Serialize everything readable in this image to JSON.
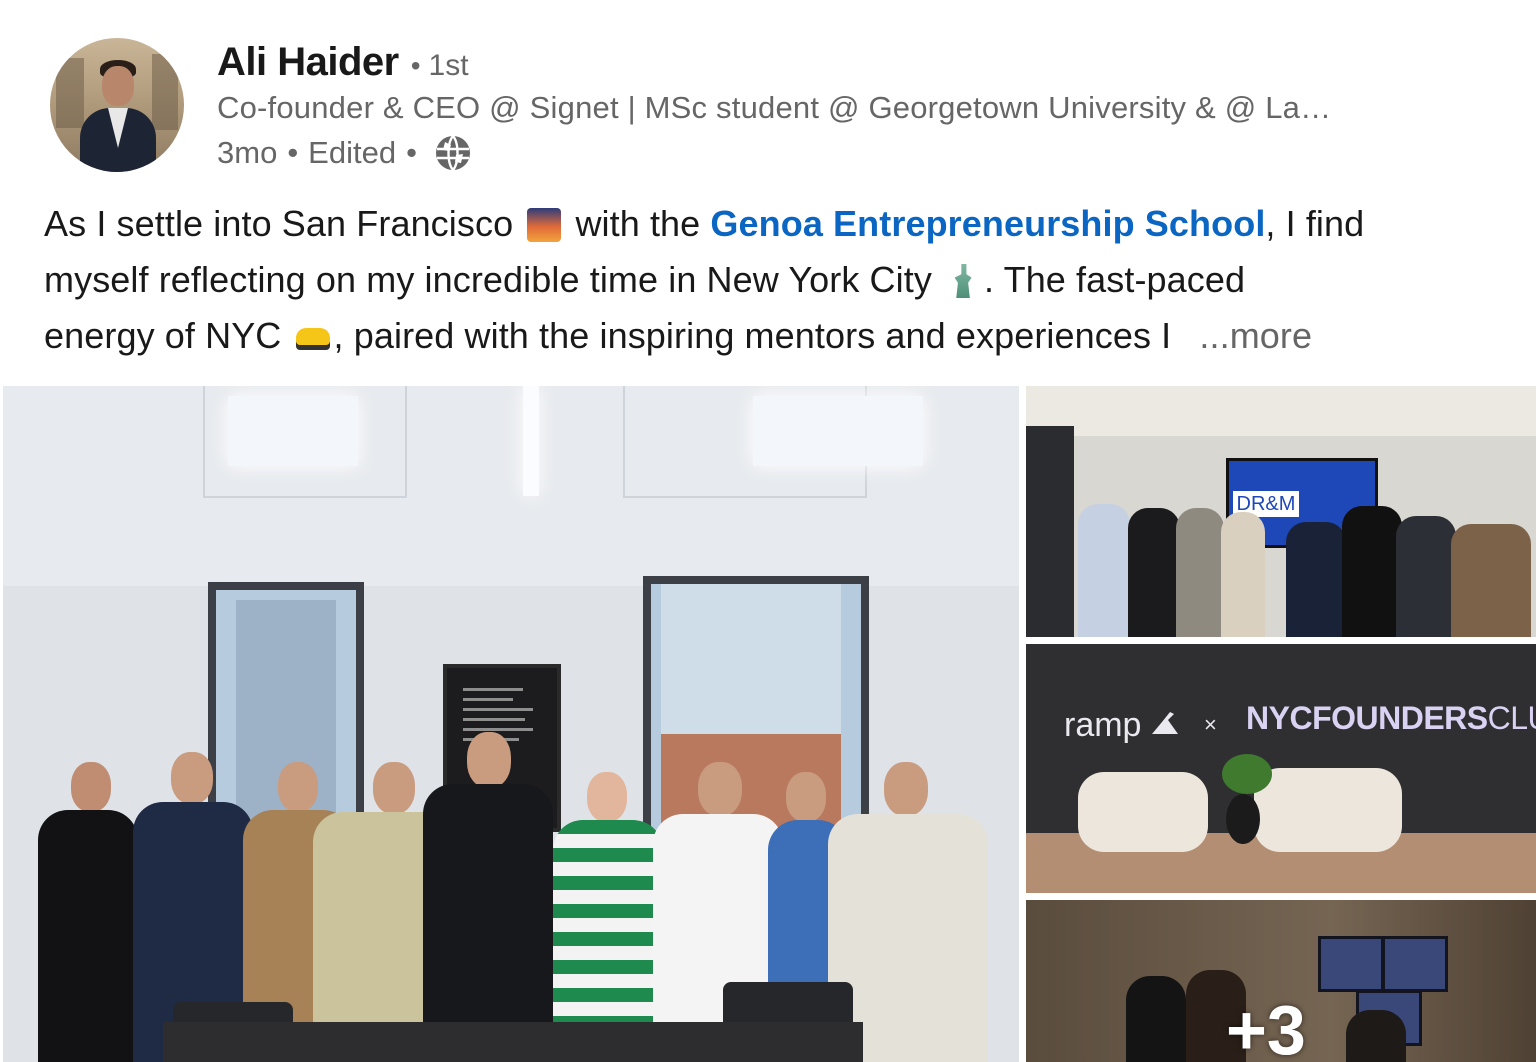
{
  "author": {
    "name": "Ali Haider",
    "degree": "1st",
    "headline": "Co-founder & CEO @ Signet | MSc student @ Georgetown University & @ La…",
    "age": "3mo",
    "edited": "Edited",
    "separator": "•",
    "visibility_icon": "globe-icon"
  },
  "post": {
    "line1_a": "As I settle into San Francisco",
    "line1_b": "with the",
    "mention": "Genoa Entrepreneurship School",
    "line1_c": ", I find",
    "line2_a": "myself reflecting on my incredible time in New York City",
    "line2_b": ". The fast-paced",
    "line3_a": "energy of NYC",
    "line3_b": ", paired with the inspiring mentors and experiences I",
    "more": "...more",
    "emojis": [
      "sunset-bridge-emoji",
      "statue-of-liberty-emoji",
      "taxi-emoji"
    ],
    "mention_color": "#0a66c2"
  },
  "gallery": {
    "photo2_screen_text": "DR&M",
    "photo3_brand_left": "ramp",
    "photo3_brand_x": "×",
    "photo3_brand_right_a": "NYC",
    "photo3_brand_right_b": "FOUNDERS",
    "photo3_brand_right_c": "CLUB",
    "extra_count": "+3"
  }
}
